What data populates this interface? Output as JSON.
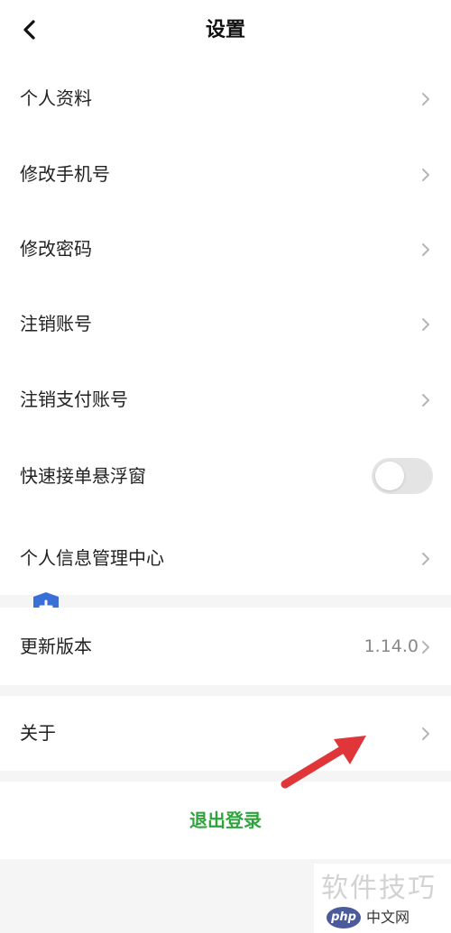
{
  "header": {
    "title": "设置",
    "back_icon": "chevron-left-icon"
  },
  "menu": {
    "profile": "个人资料",
    "change_phone": "修改手机号",
    "change_password": "修改密码",
    "cancel_account": "注销账号",
    "cancel_payment_account": "注销支付账号",
    "quick_order_float": "快速接单悬浮窗",
    "quick_order_float_on": false,
    "privacy_center": "个人信息管理中心",
    "update_version": "更新版本",
    "version_number": "1.14.0",
    "about": "关于"
  },
  "logout": {
    "label": "退出登录",
    "color": "#2fa43c"
  },
  "watermark": {
    "text": "软件技巧",
    "logo_php": "php",
    "logo_cn": "中文网"
  },
  "colors": {
    "accent": "#2fa43c",
    "shield": "#3a6fd8",
    "annotation_arrow": "#e0363a"
  }
}
